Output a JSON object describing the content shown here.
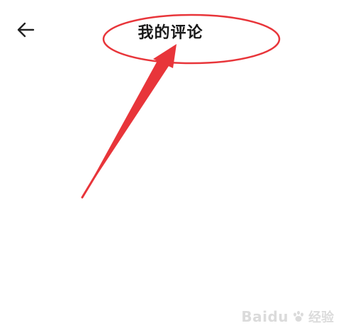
{
  "header": {
    "title": "我的评论",
    "back_icon": "arrow-left-icon"
  },
  "annotation": {
    "color": "#e8353a"
  },
  "watermark": {
    "brand": "Baidu",
    "sub": "经验",
    "color": "#9a9a9a"
  },
  "colors": {
    "background": "#ffffff",
    "title_text": "#1a1a1a"
  }
}
